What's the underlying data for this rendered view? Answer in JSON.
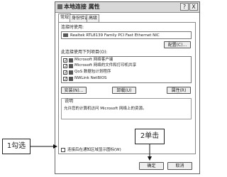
{
  "dialog": {
    "title": "本地连接 属性",
    "help_btn": "?",
    "close_btn": "X",
    "tabs": [
      "常规",
      "身份验证",
      "高级"
    ],
    "connect_using_label": "连接时使用:",
    "adapter_name": "Realtek RTL8139 Family PCI Fast Ethernet NIC",
    "configure_button": "配置(C)...",
    "items_label": "此连接使用下列项目(O):",
    "items": [
      {
        "label": "Microsoft 网络客户端",
        "checked": true
      },
      {
        "label": "Microsoft 网络的文件和打印机共享",
        "checked": true
      },
      {
        "label": "QoS 数据包计划程序",
        "checked": true
      },
      {
        "label": "NWLink NetBIOS",
        "checked": true
      }
    ],
    "install_button": "安装(N)...",
    "uninstall_button": "卸载(U)",
    "properties_button": "属性(R)",
    "description_label": "说明",
    "description_text": "允许您的计算机访问 Microsoft 网络上的资源。",
    "show_icon_checkbox_label": "连接后在通知区域显示图标(W)",
    "ok_button": "确定",
    "cancel_button": "取消"
  },
  "annotations": {
    "step1": "1勾选",
    "step2": "2单击"
  }
}
